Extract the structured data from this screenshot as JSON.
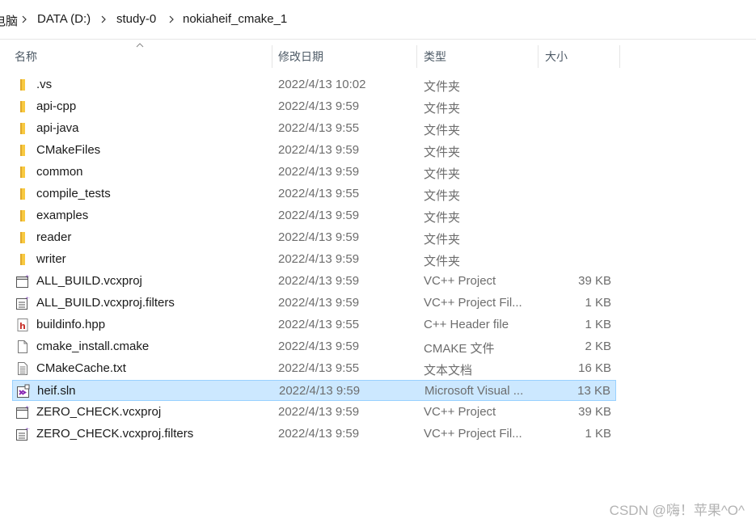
{
  "breadcrumb": {
    "items": [
      "电脑",
      "DATA (D:)",
      "study-0",
      "nokiaheif_cmake_1"
    ]
  },
  "columns": {
    "name": "名称",
    "date": "修改日期",
    "type": "类型",
    "size": "大小"
  },
  "files": [
    {
      "name": ".vs",
      "date": "2022/4/13 10:02",
      "type": "文件夹",
      "size": "",
      "icon": "folder-icon"
    },
    {
      "name": "api-cpp",
      "date": "2022/4/13 9:59",
      "type": "文件夹",
      "size": "",
      "icon": "folder-icon"
    },
    {
      "name": "api-java",
      "date": "2022/4/13 9:55",
      "type": "文件夹",
      "size": "",
      "icon": "folder-icon"
    },
    {
      "name": "CMakeFiles",
      "date": "2022/4/13 9:59",
      "type": "文件夹",
      "size": "",
      "icon": "folder-icon"
    },
    {
      "name": "common",
      "date": "2022/4/13 9:59",
      "type": "文件夹",
      "size": "",
      "icon": "folder-icon"
    },
    {
      "name": "compile_tests",
      "date": "2022/4/13 9:55",
      "type": "文件夹",
      "size": "",
      "icon": "folder-icon"
    },
    {
      "name": "examples",
      "date": "2022/4/13 9:59",
      "type": "文件夹",
      "size": "",
      "icon": "folder-icon"
    },
    {
      "name": "reader",
      "date": "2022/4/13 9:59",
      "type": "文件夹",
      "size": "",
      "icon": "folder-icon"
    },
    {
      "name": "writer",
      "date": "2022/4/13 9:59",
      "type": "文件夹",
      "size": "",
      "icon": "folder-icon"
    },
    {
      "name": "ALL_BUILD.vcxproj",
      "date": "2022/4/13 9:59",
      "type": "VC++ Project",
      "size": "39 KB",
      "icon": "vcxproj-icon"
    },
    {
      "name": "ALL_BUILD.vcxproj.filters",
      "date": "2022/4/13 9:59",
      "type": "VC++ Project Fil...",
      "size": "1 KB",
      "icon": "vcxproj-filters-icon"
    },
    {
      "name": "buildinfo.hpp",
      "date": "2022/4/13 9:55",
      "type": "C++ Header file",
      "size": "1 KB",
      "icon": "header-file-icon"
    },
    {
      "name": "cmake_install.cmake",
      "date": "2022/4/13 9:59",
      "type": "CMAKE 文件",
      "size": "2 KB",
      "icon": "blank-file-icon"
    },
    {
      "name": "CMakeCache.txt",
      "date": "2022/4/13 9:55",
      "type": "文本文档",
      "size": "16 KB",
      "icon": "text-file-icon"
    },
    {
      "name": "heif.sln",
      "date": "2022/4/13 9:59",
      "type": "Microsoft Visual ...",
      "size": "13 KB",
      "icon": "solution-icon",
      "selected": true
    },
    {
      "name": "ZERO_CHECK.vcxproj",
      "date": "2022/4/13 9:59",
      "type": "VC++ Project",
      "size": "39 KB",
      "icon": "vcxproj-icon"
    },
    {
      "name": "ZERO_CHECK.vcxproj.filters",
      "date": "2022/4/13 9:59",
      "type": "VC++ Project Fil...",
      "size": "1 KB",
      "icon": "vcxproj-filters-icon"
    }
  ],
  "watermark": "CSDN @嗨！苹果^O^",
  "colors": {
    "selection_bg": "#cce8ff",
    "selection_border": "#99d1ff",
    "folder": "#f8c941",
    "header_text": "#4d5a66",
    "meta_text": "#6d6d6d"
  }
}
